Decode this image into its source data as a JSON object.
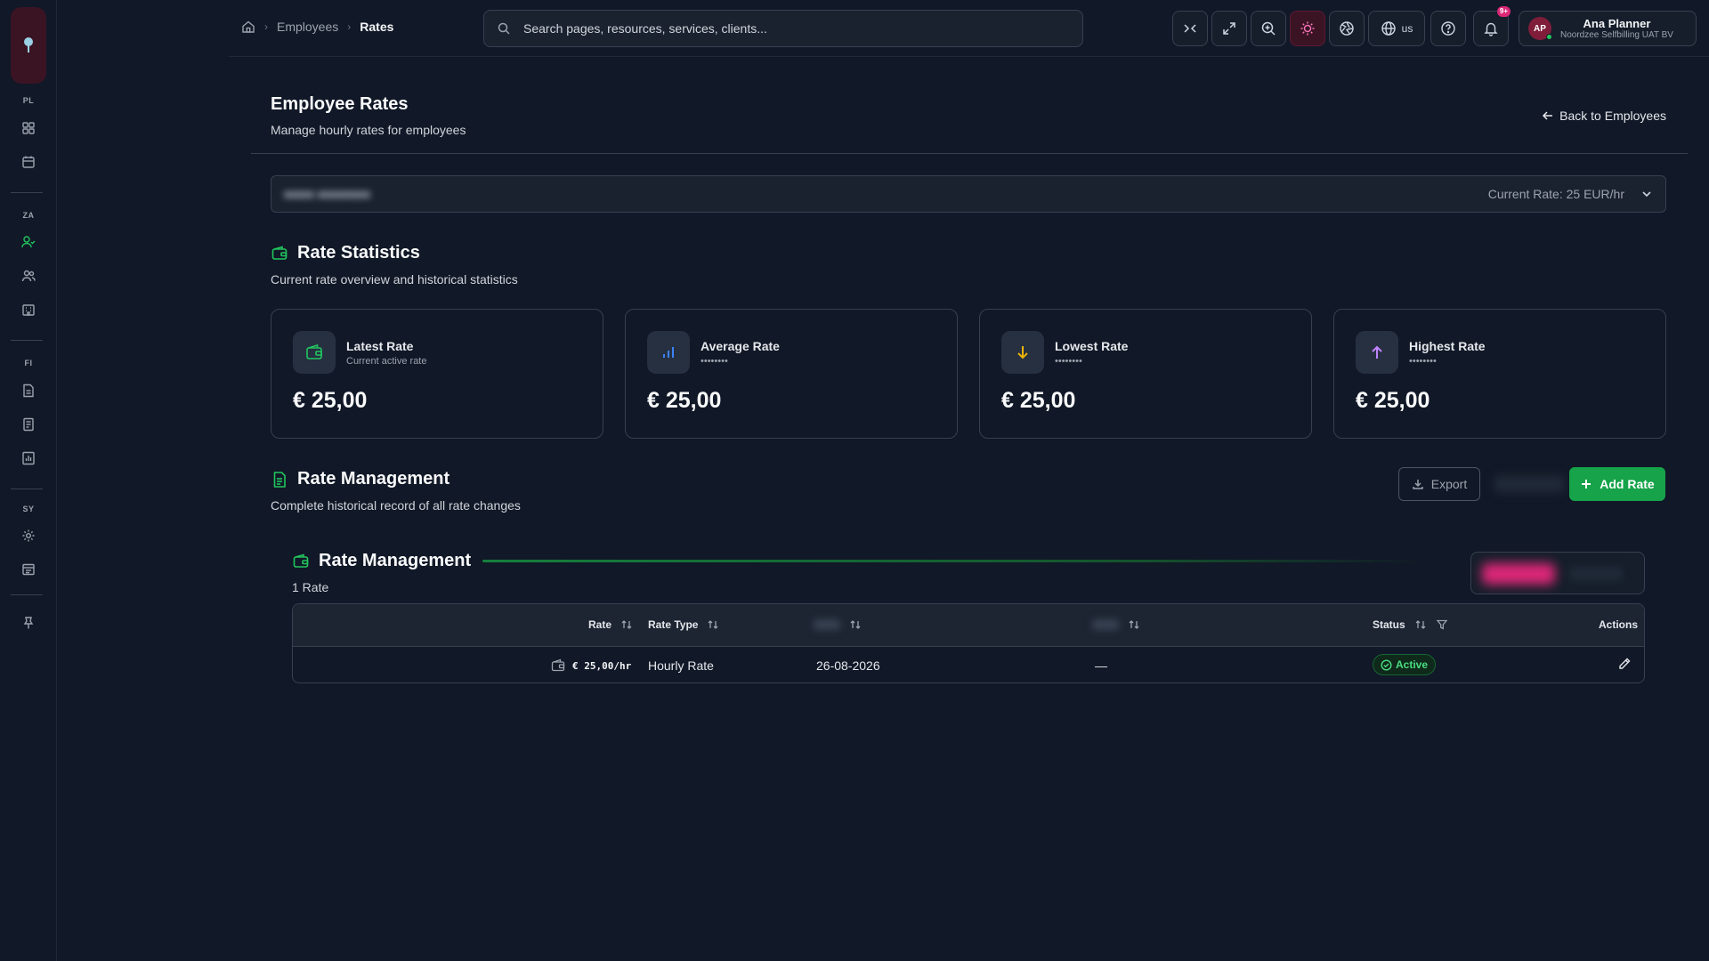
{
  "sidebar": {
    "sections": [
      "PL",
      "ZA",
      "FI",
      "SY"
    ],
    "icons": [
      "dashboard-icon",
      "calendar-icon",
      "employee-icon",
      "users-icon",
      "building-icon",
      "document-icon",
      "invoice-icon",
      "bar-chart-icon",
      "settings-icon",
      "archive-icon",
      "pin-icon"
    ]
  },
  "breadcrumb": {
    "items": [
      "Employees",
      "Rates"
    ]
  },
  "search": {
    "placeholder": "Search pages, resources, services, clients..."
  },
  "topbar": {
    "language": "us",
    "notification_count": "9+",
    "user": {
      "initials": "AP",
      "name": "Ana Planner",
      "org": "Noordzee Selfbilling UAT BV"
    }
  },
  "page": {
    "title": "Employee Rates",
    "subtitle": "Manage hourly rates for employees",
    "back_link": "Back to Employees"
  },
  "selector": {
    "current_rate": "Current Rate: 25 EUR/hr"
  },
  "stats": {
    "title": "Rate Statistics",
    "subtitle": "Current rate overview and historical statistics",
    "cards": [
      {
        "label": "Latest Rate",
        "hint": "Current active rate",
        "value": "€ 25,00",
        "icon": "wallet-icon",
        "color": "#22c55e"
      },
      {
        "label": "Average Rate",
        "hint": "••••••••",
        "value": "€ 25,00",
        "icon": "bar-chart-icon",
        "color": "#3b82f6"
      },
      {
        "label": "Lowest Rate",
        "hint": "••••••••",
        "value": "€ 25,00",
        "icon": "arrow-down-icon",
        "color": "#eab308"
      },
      {
        "label": "Highest Rate",
        "hint": "••••••••",
        "value": "€ 25,00",
        "icon": "arrow-up-icon",
        "color": "#c084fc"
      }
    ]
  },
  "management": {
    "title": "Rate Management",
    "subtitle": "Complete historical record of all rate changes",
    "export_label": "Export",
    "add_label": "Add Rate",
    "inner_title": "Rate Management",
    "count": "1 Rate",
    "table": {
      "headers": {
        "rate": "Rate",
        "rate_type": "Rate Type",
        "status": "Status",
        "actions": "Actions"
      },
      "rows": [
        {
          "rate": "€ 25,00/hr",
          "rate_type": "Hourly Rate",
          "start_date": "26-08-2026",
          "end_date": "—",
          "status": "Active"
        }
      ]
    }
  },
  "colors": {
    "accent": "#16a34a",
    "brand": "#db2777",
    "background": "#111827"
  }
}
